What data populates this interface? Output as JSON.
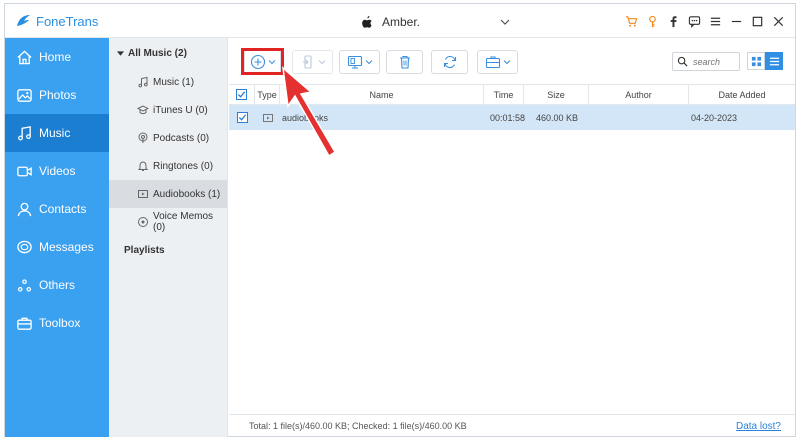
{
  "app": {
    "title": "FoneTrans"
  },
  "device": {
    "name": "Amber."
  },
  "sidebar": {
    "items": [
      {
        "label": "Home",
        "icon": "home-icon"
      },
      {
        "label": "Photos",
        "icon": "photos-icon"
      },
      {
        "label": "Music",
        "icon": "music-icon",
        "active": true
      },
      {
        "label": "Videos",
        "icon": "videos-icon"
      },
      {
        "label": "Contacts",
        "icon": "contacts-icon"
      },
      {
        "label": "Messages",
        "icon": "messages-icon"
      },
      {
        "label": "Others",
        "icon": "others-icon"
      },
      {
        "label": "Toolbox",
        "icon": "toolbox-icon"
      }
    ]
  },
  "categories": {
    "header": "All Music (2)",
    "items": [
      {
        "label": "Music (1)"
      },
      {
        "label": "iTunes U (0)"
      },
      {
        "label": "Podcasts (0)"
      },
      {
        "label": "Ringtones (0)"
      },
      {
        "label": "Audiobooks (1)",
        "active": true
      },
      {
        "label": "Voice Memos (0)"
      }
    ],
    "playlists": "Playlists"
  },
  "search": {
    "placeholder": "search"
  },
  "table": {
    "columns": {
      "type": "Type",
      "name": "Name",
      "time": "Time",
      "size": "Size",
      "author": "Author",
      "date": "Date Added"
    },
    "rows": [
      {
        "name": "audiobooks",
        "time": "00:01:58",
        "size": "460.00 KB",
        "author": "",
        "date": "04-20-2023"
      }
    ]
  },
  "status": {
    "text": "Total: 1 file(s)/460.00 KB; Checked: 1 file(s)/460.00 KB",
    "link": "Data lost?"
  },
  "colors": {
    "accent": "#3aa0f0",
    "active": "#1b7ed0",
    "highlight": "#e02424",
    "selected_row": "#d3e6f8"
  }
}
